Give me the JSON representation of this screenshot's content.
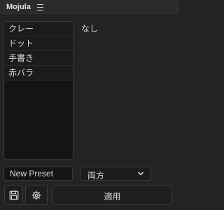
{
  "header": {
    "title": "Mojula",
    "menu_icon": "hamburger-menu-icon"
  },
  "preset_list": {
    "items": [
      {
        "label": "クレー"
      },
      {
        "label": "ドット"
      },
      {
        "label": "手書き"
      },
      {
        "label": "赤バラ"
      }
    ]
  },
  "preview": {
    "text": "なし"
  },
  "controls": {
    "preset_name_value": "New Preset",
    "mode_select_value": "両方",
    "save_icon": "floppy-disk-icon",
    "settings_icon": "gear-icon",
    "apply_label": "適用"
  }
}
